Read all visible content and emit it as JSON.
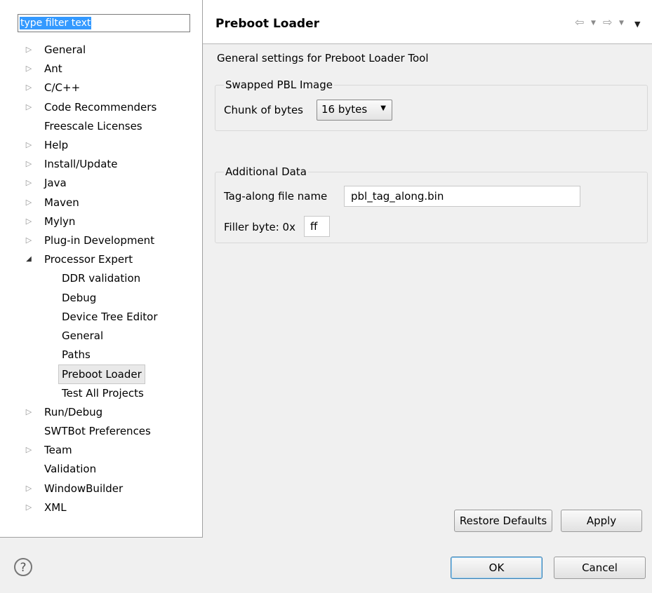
{
  "filter": {
    "placeholder": "type filter text"
  },
  "tree": [
    {
      "label": "General",
      "expander": "collapsed"
    },
    {
      "label": "Ant",
      "expander": "collapsed"
    },
    {
      "label": "C/C++",
      "expander": "collapsed"
    },
    {
      "label": "Code Recommenders",
      "expander": "collapsed"
    },
    {
      "label": "Freescale Licenses",
      "expander": "none"
    },
    {
      "label": "Help",
      "expander": "collapsed"
    },
    {
      "label": "Install/Update",
      "expander": "collapsed"
    },
    {
      "label": "Java",
      "expander": "collapsed"
    },
    {
      "label": "Maven",
      "expander": "collapsed"
    },
    {
      "label": "Mylyn",
      "expander": "collapsed"
    },
    {
      "label": "Plug-in Development",
      "expander": "collapsed"
    },
    {
      "label": "Processor Expert",
      "expander": "expanded"
    },
    {
      "label": "DDR validation",
      "expander": "none",
      "child": true
    },
    {
      "label": "Debug",
      "expander": "none",
      "child": true
    },
    {
      "label": "Device Tree Editor",
      "expander": "none",
      "child": true
    },
    {
      "label": "General",
      "expander": "none",
      "child": true
    },
    {
      "label": "Paths",
      "expander": "none",
      "child": true
    },
    {
      "label": "Preboot Loader",
      "expander": "none",
      "child": true,
      "selected": true
    },
    {
      "label": "Test All Projects",
      "expander": "none",
      "child": true
    },
    {
      "label": "Run/Debug",
      "expander": "collapsed"
    },
    {
      "label": "SWTBot Preferences",
      "expander": "none"
    },
    {
      "label": "Team",
      "expander": "collapsed"
    },
    {
      "label": "Validation",
      "expander": "none"
    },
    {
      "label": "WindowBuilder",
      "expander": "collapsed"
    },
    {
      "label": "XML",
      "expander": "collapsed"
    }
  ],
  "page": {
    "title": "Preboot Loader",
    "description": "General settings for Preboot Loader Tool",
    "group1": {
      "legend": "Swapped PBL Image",
      "chunk_label": "Chunk of bytes",
      "chunk_value": "16 bytes"
    },
    "group2": {
      "legend": "Additional Data",
      "tag_label": "Tag-along file name",
      "tag_value": "pbl_tag_along.bin",
      "filler_label": "Filler byte: 0x",
      "filler_value": "ff"
    },
    "restore_label": "Restore Defaults",
    "apply_label": "Apply"
  },
  "footer": {
    "help_glyph": "?",
    "ok_label": "OK",
    "cancel_label": "Cancel"
  },
  "icons": {
    "back": "back-arrow-icon",
    "forward": "forward-arrow-icon",
    "menu": "view-menu-icon"
  }
}
